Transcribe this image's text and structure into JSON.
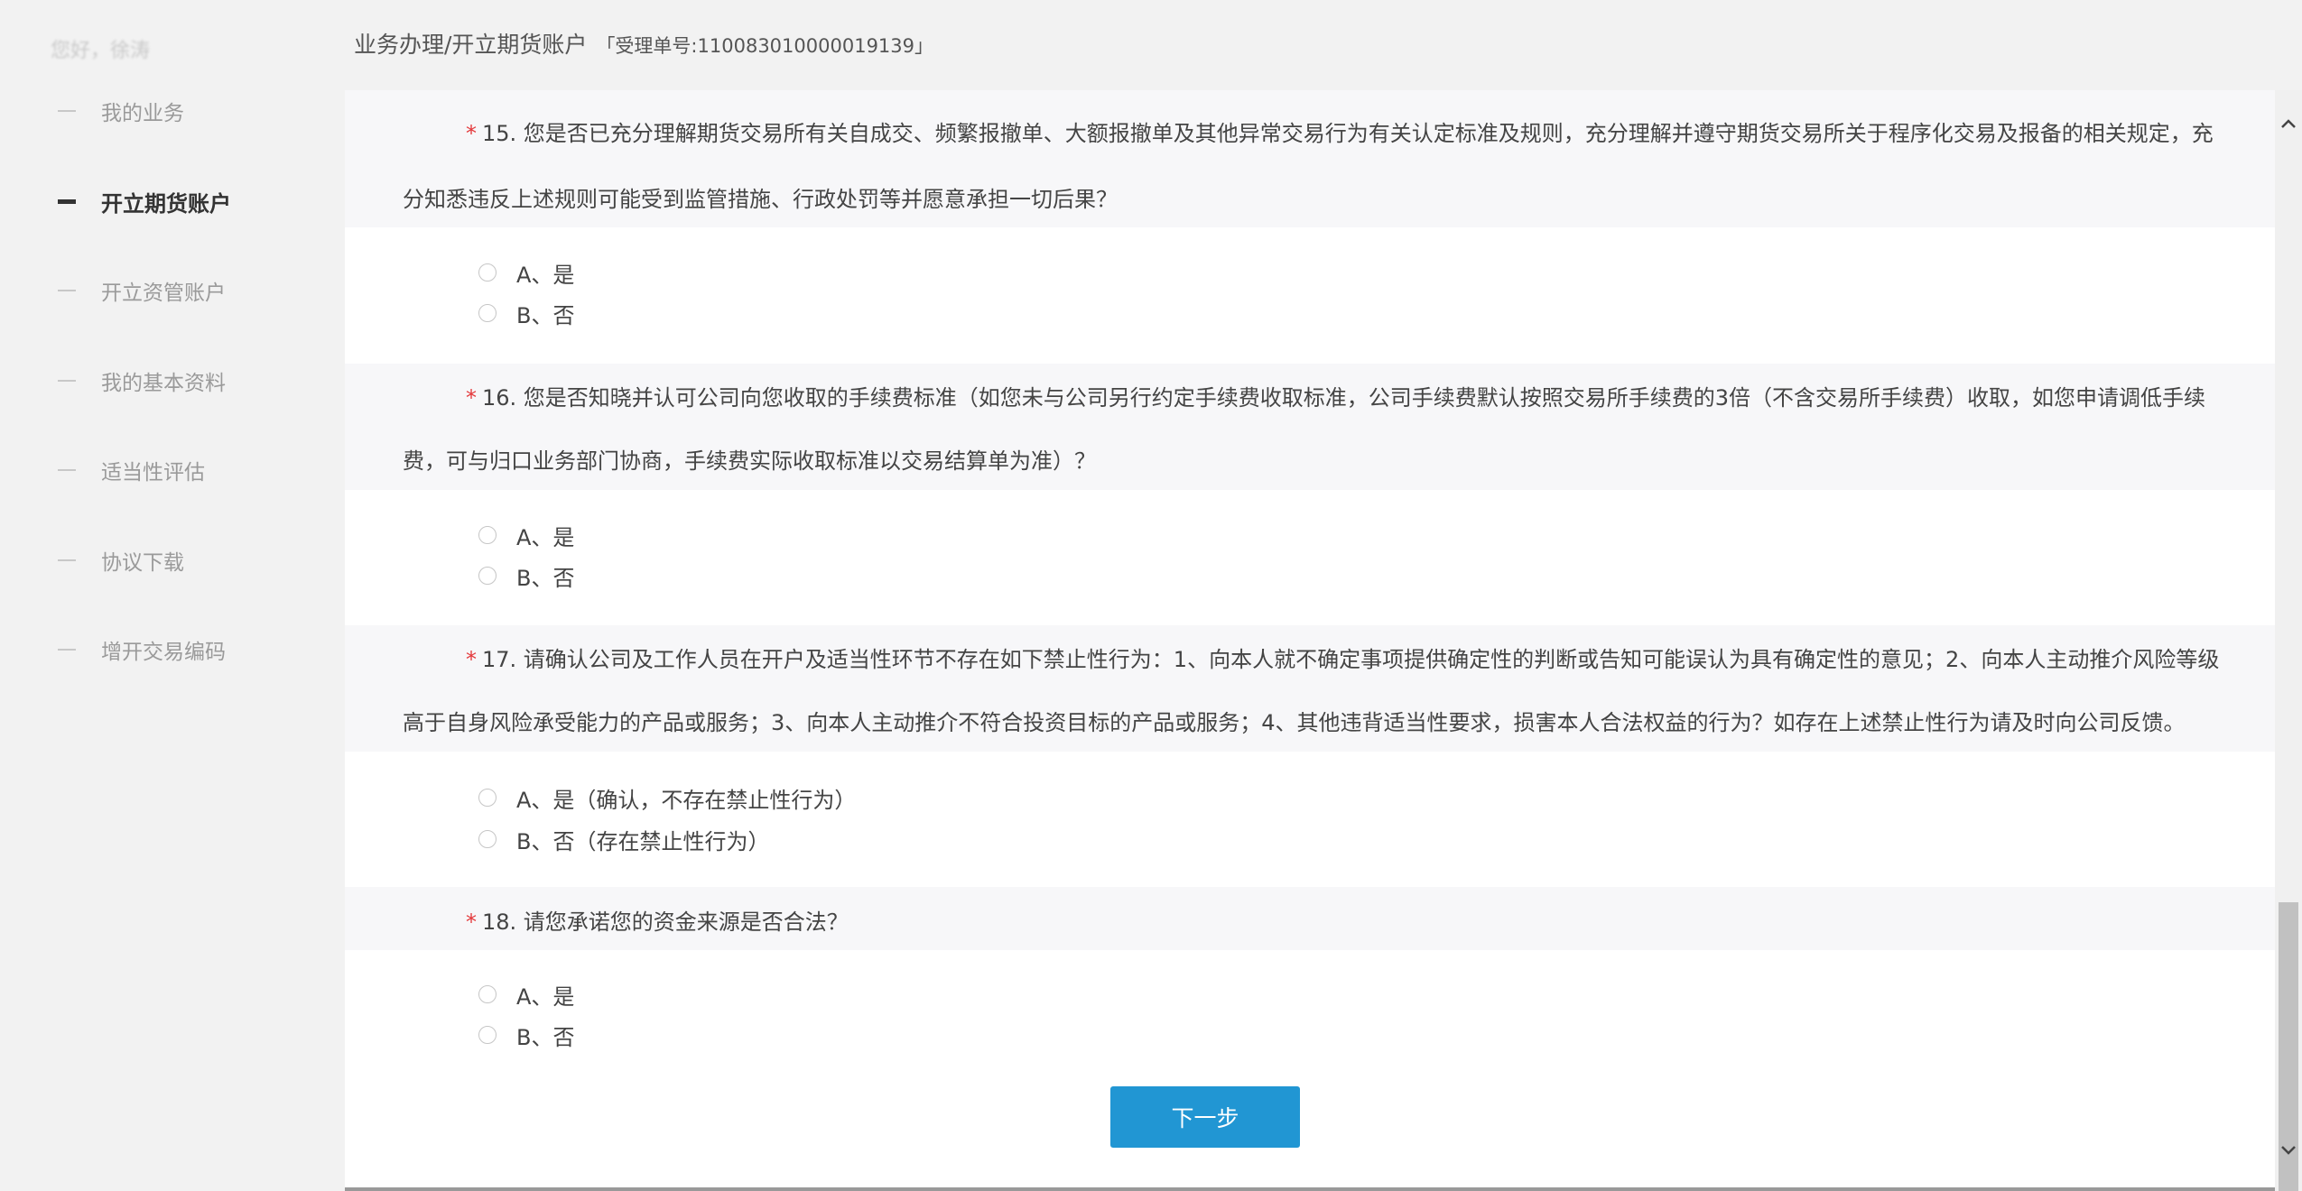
{
  "sidebar": {
    "greeting": "您好，徐涛",
    "items": [
      {
        "label": "我的业务"
      },
      {
        "label": "开立期货账户"
      },
      {
        "label": "开立资管账户"
      },
      {
        "label": "我的基本资料"
      },
      {
        "label": "适当性评估"
      },
      {
        "label": "协议下载"
      },
      {
        "label": "增开交易编码"
      }
    ]
  },
  "header": {
    "breadcrumb": "业务办理/开立期货账户",
    "acceptance_number": "「受理单号:110083010000019139」"
  },
  "questions": [
    {
      "required_mark": "*",
      "line1": "15. 您是否已充分理解期货交易所有关自成交、频繁报撤单、大额报撤单及其他异常交易行为有关认定标准及规则，充分理解并遵守期货交易所关于程序化交易及报备的相关规定，充",
      "line2": "分知悉违反上述规则可能受到监管措施、行政处罚等并愿意承担一切后果？",
      "options": [
        "A、是",
        "B、否"
      ]
    },
    {
      "required_mark": "*",
      "line1": "16. 您是否知晓并认可公司向您收取的手续费标准（如您未与公司另行约定手续费收取标准，公司手续费默认按照交易所手续费的3倍（不含交易所手续费）收取，如您申请调低手续",
      "line2": "费，可与归口业务部门协商，手续费实际收取标准以交易结算单为准）？",
      "options": [
        "A、是",
        "B、否"
      ]
    },
    {
      "required_mark": "*",
      "line1": "17. 请确认公司及工作人员在开户及适当性环节不存在如下禁止性行为：1、向本人就不确定事项提供确定性的判断或告知可能误认为具有确定性的意见；2、向本人主动推介风险等级",
      "line2": "高于自身风险承受能力的产品或服务；3、向本人主动推介不符合投资目标的产品或服务；4、其他违背适当性要求，损害本人合法权益的行为？如存在上述禁止性行为请及时向公司反馈。",
      "options": [
        "A、是（确认，不存在禁止性行为）",
        "B、否（存在禁止性行为）"
      ]
    },
    {
      "required_mark": "*",
      "line1": "18. 请您承诺您的资金来源是否合法？",
      "options": [
        "A、是",
        "B、否"
      ]
    }
  ],
  "actions": {
    "next_label": "下一步"
  },
  "scrollbar": {
    "up_icon": "chevron-up-icon",
    "down_icon": "chevron-down-icon"
  }
}
